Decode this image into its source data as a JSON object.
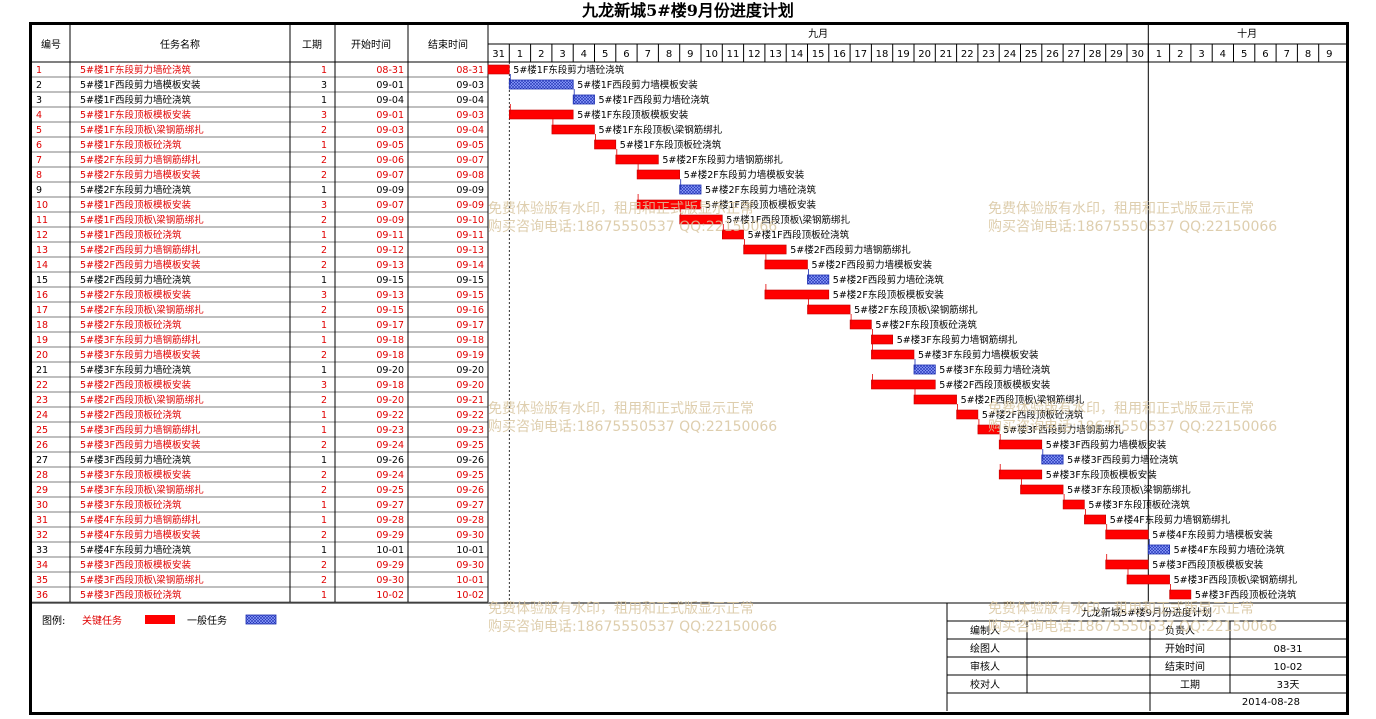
{
  "title": "九龙新城5#楼9月份进度计划",
  "headers": {
    "id": "编号",
    "name": "任务名称",
    "duration": "工期",
    "start": "开始时间",
    "end": "结束时间"
  },
  "months": [
    {
      "label": "九月"
    },
    {
      "label": "十月"
    }
  ],
  "day_labels": [
    "31",
    "1",
    "2",
    "3",
    "4",
    "5",
    "6",
    "7",
    "8",
    "9",
    "10",
    "11",
    "12",
    "13",
    "14",
    "15",
    "16",
    "17",
    "18",
    "19",
    "20",
    "21",
    "22",
    "23",
    "24",
    "25",
    "26",
    "27",
    "28",
    "29",
    "30",
    "1",
    "2",
    "3",
    "4",
    "5",
    "6",
    "7",
    "8",
    "9"
  ],
  "colors": {
    "critical": "#ff0000",
    "normal": "#2b3fd6",
    "critical_text": "#e00000",
    "normal_text": "#000000",
    "watermark": "#d9c6a0"
  },
  "chart_data": {
    "type": "table",
    "tasks": [
      {
        "id": "1",
        "name": "5#楼1F东段剪力墙砼浇筑",
        "duration": 1,
        "start": "08-31",
        "end": "08-31",
        "critical": true
      },
      {
        "id": "2",
        "name": "5#楼1F西段剪力墙模板安装",
        "duration": 3,
        "start": "09-01",
        "end": "09-03",
        "critical": false
      },
      {
        "id": "3",
        "name": "5#楼1F西段剪力墙砼浇筑",
        "duration": 1,
        "start": "09-04",
        "end": "09-04",
        "critical": false
      },
      {
        "id": "4",
        "name": "5#楼1F东段顶板模板安装",
        "duration": 3,
        "start": "09-01",
        "end": "09-03",
        "critical": true
      },
      {
        "id": "5",
        "name": "5#楼1F东段顶板\\梁钢筋绑扎",
        "duration": 2,
        "start": "09-03",
        "end": "09-04",
        "critical": true
      },
      {
        "id": "6",
        "name": "5#楼1F东段顶板砼浇筑",
        "duration": 1,
        "start": "09-05",
        "end": "09-05",
        "critical": true
      },
      {
        "id": "7",
        "name": "5#楼2F东段剪力墙钢筋绑扎",
        "duration": 2,
        "start": "09-06",
        "end": "09-07",
        "critical": true
      },
      {
        "id": "8",
        "name": "5#楼2F东段剪力墙模板安装",
        "duration": 2,
        "start": "09-07",
        "end": "09-08",
        "critical": true
      },
      {
        "id": "9",
        "name": "5#楼2F东段剪力墙砼浇筑",
        "duration": 1,
        "start": "09-09",
        "end": "09-09",
        "critical": false
      },
      {
        "id": "10",
        "name": "5#楼1F西段顶板模板安装",
        "duration": 3,
        "start": "09-07",
        "end": "09-09",
        "critical": true
      },
      {
        "id": "11",
        "name": "5#楼1F西段顶板\\梁钢筋绑扎",
        "duration": 2,
        "start": "09-09",
        "end": "09-10",
        "critical": true
      },
      {
        "id": "12",
        "name": "5#楼1F西段顶板砼浇筑",
        "duration": 1,
        "start": "09-11",
        "end": "09-11",
        "critical": true
      },
      {
        "id": "13",
        "name": "5#楼2F西段剪力墙钢筋绑扎",
        "duration": 2,
        "start": "09-12",
        "end": "09-13",
        "critical": true
      },
      {
        "id": "14",
        "name": "5#楼2F西段剪力墙模板安装",
        "duration": 2,
        "start": "09-13",
        "end": "09-14",
        "critical": true
      },
      {
        "id": "15",
        "name": "5#楼2F西段剪力墙砼浇筑",
        "duration": 1,
        "start": "09-15",
        "end": "09-15",
        "critical": false
      },
      {
        "id": "16",
        "name": "5#楼2F东段顶板模板安装",
        "duration": 3,
        "start": "09-13",
        "end": "09-15",
        "critical": true
      },
      {
        "id": "17",
        "name": "5#楼2F东段顶板\\梁钢筋绑扎",
        "duration": 2,
        "start": "09-15",
        "end": "09-16",
        "critical": true
      },
      {
        "id": "18",
        "name": "5#楼2F东段顶板砼浇筑",
        "duration": 1,
        "start": "09-17",
        "end": "09-17",
        "critical": true
      },
      {
        "id": "19",
        "name": "5#楼3F东段剪力墙钢筋绑扎",
        "duration": 1,
        "start": "09-18",
        "end": "09-18",
        "critical": true
      },
      {
        "id": "20",
        "name": "5#楼3F东段剪力墙模板安装",
        "duration": 2,
        "start": "09-18",
        "end": "09-19",
        "critical": true
      },
      {
        "id": "21",
        "name": "5#楼3F东段剪力墙砼浇筑",
        "duration": 1,
        "start": "09-20",
        "end": "09-20",
        "critical": false
      },
      {
        "id": "22",
        "name": "5#楼2F西段顶板模板安装",
        "duration": 3,
        "start": "09-18",
        "end": "09-20",
        "critical": true
      },
      {
        "id": "23",
        "name": "5#楼2F西段顶板\\梁钢筋绑扎",
        "duration": 2,
        "start": "09-20",
        "end": "09-21",
        "critical": true
      },
      {
        "id": "24",
        "name": "5#楼2F西段顶板砼浇筑",
        "duration": 1,
        "start": "09-22",
        "end": "09-22",
        "critical": true
      },
      {
        "id": "25",
        "name": "5#楼3F西段剪力墙钢筋绑扎",
        "duration": 1,
        "start": "09-23",
        "end": "09-23",
        "critical": true
      },
      {
        "id": "26",
        "name": "5#楼3F西段剪力墙模板安装",
        "duration": 2,
        "start": "09-24",
        "end": "09-25",
        "critical": true
      },
      {
        "id": "27",
        "name": "5#楼3F西段剪力墙砼浇筑",
        "duration": 1,
        "start": "09-26",
        "end": "09-26",
        "critical": false
      },
      {
        "id": "28",
        "name": "5#楼3F东段顶板模板安装",
        "duration": 2,
        "start": "09-24",
        "end": "09-25",
        "critical": true
      },
      {
        "id": "29",
        "name": "5#楼3F东段顶板\\梁钢筋绑扎",
        "duration": 2,
        "start": "09-25",
        "end": "09-26",
        "critical": true
      },
      {
        "id": "30",
        "name": "5#楼3F东段顶板砼浇筑",
        "duration": 1,
        "start": "09-27",
        "end": "09-27",
        "critical": true
      },
      {
        "id": "31",
        "name": "5#楼4F东段剪力墙钢筋绑扎",
        "duration": 1,
        "start": "09-28",
        "end": "09-28",
        "critical": true
      },
      {
        "id": "32",
        "name": "5#楼4F东段剪力墙模板安装",
        "duration": 2,
        "start": "09-29",
        "end": "09-30",
        "critical": true
      },
      {
        "id": "33",
        "name": "5#楼4F东段剪力墙砼浇筑",
        "duration": 1,
        "start": "10-01",
        "end": "10-01",
        "critical": false
      },
      {
        "id": "34",
        "name": "5#楼3F西段顶板模板安装",
        "duration": 2,
        "start": "09-29",
        "end": "09-30",
        "critical": true
      },
      {
        "id": "35",
        "name": "5#楼3F西段顶板\\梁钢筋绑扎",
        "duration": 2,
        "start": "09-30",
        "end": "10-01",
        "critical": true
      },
      {
        "id": "36",
        "name": "5#楼3F西段顶板砼浇筑",
        "duration": 1,
        "start": "10-02",
        "end": "10-02",
        "critical": true
      }
    ]
  },
  "legend": {
    "label": "图例:",
    "critical": "关键任务",
    "normal": "一般任务"
  },
  "info": {
    "title": "九龙新城5#楼9月份进度计划",
    "made_by": "编制人",
    "drawn_by": "绘图人",
    "reviewed_by": "审核人",
    "checked_by": "校对人",
    "owner": "负责人",
    "start_label": "开始时间",
    "end_label": "结束时间",
    "duration_label": "工期",
    "start": "08-31",
    "end": "10-02",
    "duration": "33天",
    "date": "2014-08-28"
  },
  "watermark": {
    "line1": "免费体验版有水印，租用和正式版显示正常",
    "line2": "购买咨询电话:18675550537 QQ:22150066"
  }
}
